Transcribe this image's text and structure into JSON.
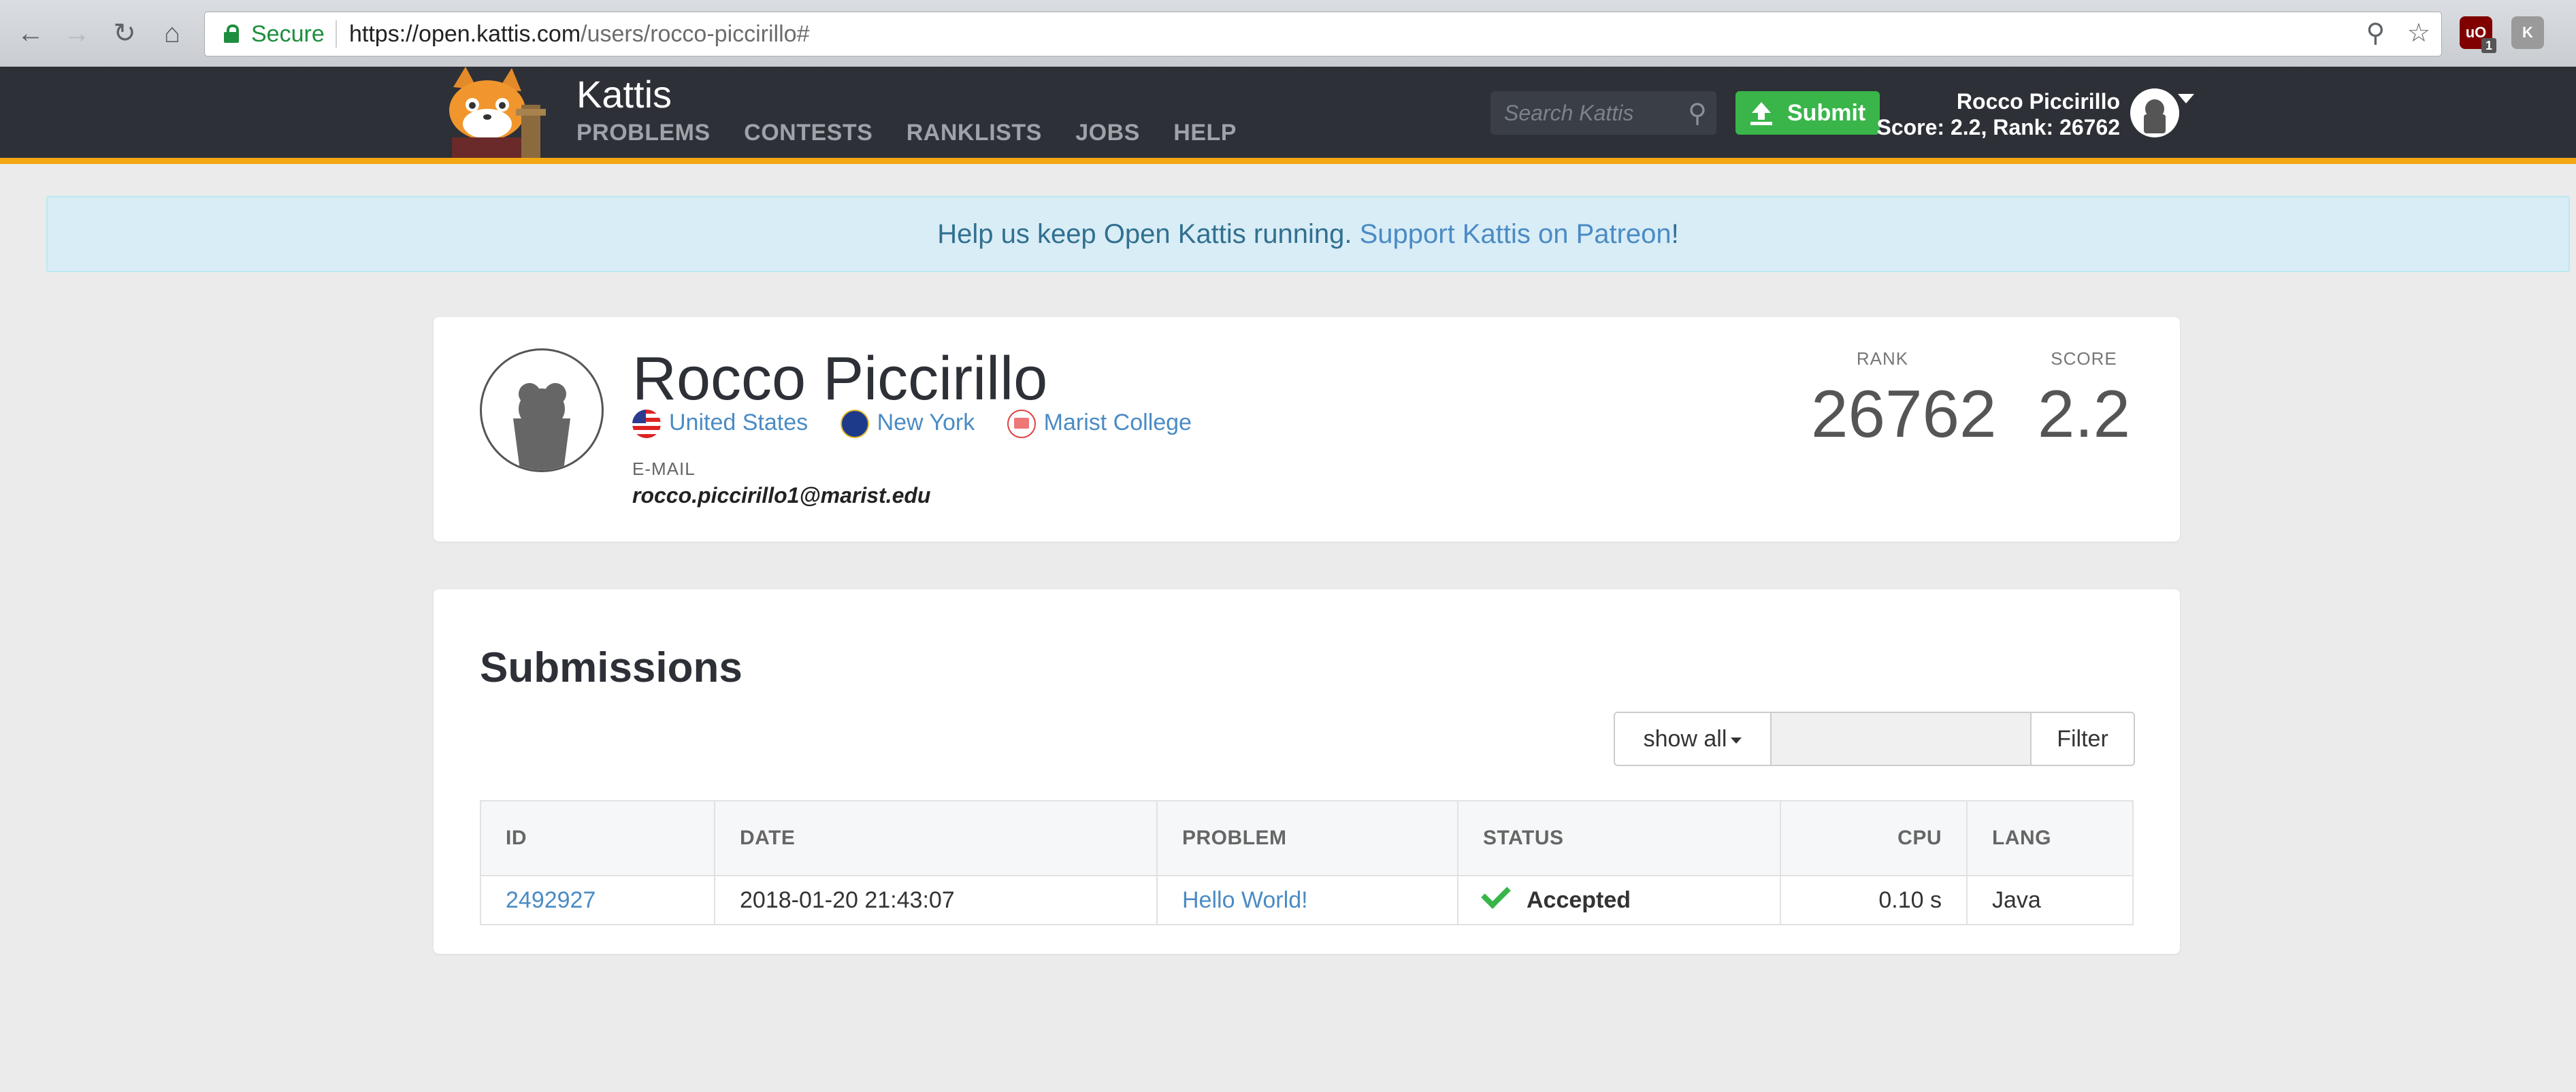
{
  "browser": {
    "secure_label": "Secure",
    "url_host": "https://open.kattis.com",
    "url_path": "/users/rocco-piccirillo#",
    "extension_count": "1"
  },
  "navbar": {
    "brand": "Kattis",
    "menu": [
      "PROBLEMS",
      "CONTESTS",
      "RANKLISTS",
      "JOBS",
      "HELP"
    ],
    "search_placeholder": "Search Kattis",
    "submit_label": "Submit",
    "user_name": "Rocco Piccirillo",
    "user_stats": "Score: 2.2, Rank: 26762",
    "accent_color": "#f3a712"
  },
  "banner": {
    "text": "Help us keep Open Kattis running.",
    "link": "Support Kattis on Patreon",
    "suffix": "!"
  },
  "profile": {
    "name": "Rocco Piccirillo",
    "country": "United States",
    "state": "New York",
    "school": "Marist College",
    "email_label": "E-MAIL",
    "email": "rocco.piccirillo1@marist.edu",
    "rank_label": "RANK",
    "rank": "26762",
    "score_label": "SCORE",
    "score": "2.2"
  },
  "submissions": {
    "title": "Submissions",
    "filter_select": "show all",
    "filter_button": "Filter",
    "columns": [
      "ID",
      "DATE",
      "PROBLEM",
      "STATUS",
      "CPU",
      "LANG"
    ],
    "rows": [
      {
        "id": "2492927",
        "date": "2018-01-20 21:43:07",
        "problem": "Hello World!",
        "status": "Accepted",
        "cpu": "0.10 s",
        "lang": "Java"
      }
    ]
  }
}
